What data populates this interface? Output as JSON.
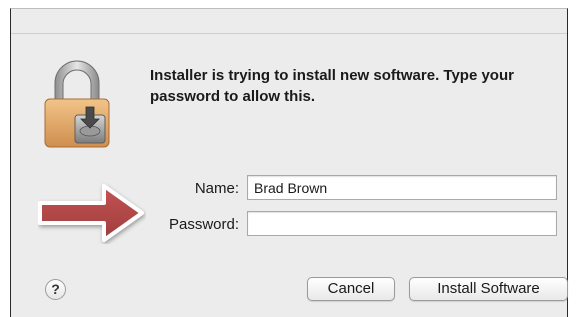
{
  "dialog": {
    "message": "Installer is trying to install new software. Type your password to allow this.",
    "name_label": "Name:",
    "name_value": "Brad Brown",
    "password_label": "Password:",
    "password_value": "",
    "help_label": "?",
    "cancel_label": "Cancel",
    "install_label": "Install Software"
  },
  "icons": {
    "lock": "padlock-installer-icon",
    "arrow": "red-arrow-annotation"
  },
  "colors": {
    "arrow": "#b94a4a",
    "lock_body": "#e3ad6d",
    "background": "#ececec"
  }
}
